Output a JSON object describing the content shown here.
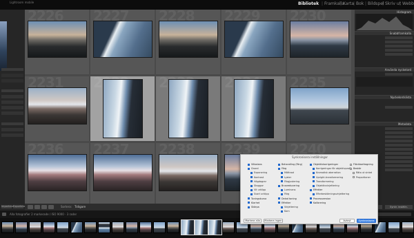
{
  "app": {
    "subtitle": "Lightroom mobile",
    "modules": [
      {
        "label": "Bibliotek",
        "active": true
      },
      {
        "label": "Framkalla",
        "active": false
      },
      {
        "label": "Karta",
        "active": false
      },
      {
        "label": "Bok",
        "active": false
      },
      {
        "label": "Bildspel",
        "active": false
      },
      {
        "label": "Skriv ut",
        "active": false
      },
      {
        "label": "Webb",
        "active": false
      }
    ]
  },
  "grid": {
    "cells": [
      {
        "num": "2226",
        "info": "",
        "thumb": "t-arch",
        "state": "normal"
      },
      {
        "num": "2227",
        "info": "",
        "thumb": "t-shore",
        "state": "normal"
      },
      {
        "num": "2228",
        "info": "",
        "thumb": "t-arch",
        "state": "normal"
      },
      {
        "num": "2229",
        "info": "",
        "thumb": "t-shore",
        "state": "normal"
      },
      {
        "num": "2230",
        "info": "",
        "thumb": "t-sunset",
        "state": "normal"
      },
      {
        "num": "2231",
        "info": "",
        "thumb": "t-mnt",
        "state": "normal"
      },
      {
        "num": "2232",
        "info": "",
        "thumb": "t-vert",
        "state": "hl"
      },
      {
        "num": "2233",
        "info": "",
        "thumb": "t-vert",
        "state": "sel"
      },
      {
        "num": "2234",
        "info": "",
        "thumb": "t-vert",
        "state": "sel"
      },
      {
        "num": "2235",
        "info": "",
        "thumb": "t-flat",
        "state": "normal"
      },
      {
        "num": "2236",
        "info": "",
        "thumb": "t-mnt2",
        "state": "normal"
      },
      {
        "num": "2237",
        "info": "",
        "thumb": "t-mnt2",
        "state": "normal"
      },
      {
        "num": "2238",
        "info": "",
        "thumb": "t-mnt",
        "state": "normal"
      },
      {
        "num": "2239",
        "info": "",
        "thumb": "t-sunset",
        "state": "normal"
      },
      {
        "num": "2240",
        "info": "",
        "thumb": "t-flat",
        "state": "normal"
      }
    ]
  },
  "right_panel": {
    "histogram_title": "Histogram",
    "quick_develop_title": "Snabbframkalla",
    "keywording_title": "Använda nyckelord",
    "keyword_list_title": "Nyckelordslista",
    "metadata_title": "Metadata",
    "sync_button": "Synkronisera",
    "sync_settings_button": "Synkr. inställn."
  },
  "left_panel": {
    "import_button": "Importera...",
    "export_button": "Exportera..."
  },
  "toolbar": {
    "sort_label": "Sortera:",
    "sort_value": "Tidigare",
    "thumbnails_label": "Miniatyrer"
  },
  "filmbar": {
    "path_text": "Alla fotografier   2 markerade / ISO 9000 · 3 rader",
    "filter_label": "Filter:"
  },
  "dialog": {
    "title": "Synkronisera inställningar",
    "col1": [
      {
        "label": "Vitbalans",
        "sub": false,
        "checked": true
      },
      {
        "label": "Grund",
        "sub": false,
        "checked": true
      },
      {
        "label": "Exponering",
        "sub": true,
        "checked": true
      },
      {
        "label": "Kontrast",
        "sub": true,
        "checked": true
      },
      {
        "label": "Högdagrar",
        "sub": true,
        "checked": true
      },
      {
        "label": "Skuggor",
        "sub": true,
        "checked": true
      },
      {
        "label": "Vit urklipp",
        "sub": true,
        "checked": true
      },
      {
        "label": "Svart urklipp",
        "sub": true,
        "checked": true
      },
      {
        "label": "Toningskurva",
        "sub": false,
        "checked": true
      },
      {
        "label": "Klarhet",
        "sub": false,
        "checked": true
      },
      {
        "label": "Skärpa",
        "sub": false,
        "checked": true
      }
    ],
    "col2": [
      {
        "label": "Behandling (Färg)",
        "sub": false,
        "checked": true
      },
      {
        "label": "Färg",
        "sub": false,
        "checked": true
      },
      {
        "label": "Mättnad",
        "sub": true,
        "checked": true
      },
      {
        "label": "Lyster",
        "sub": true,
        "checked": true
      },
      {
        "label": "Färgjustering",
        "sub": true,
        "checked": true
      },
      {
        "label": "Brusreducering",
        "sub": false,
        "checked": true
      },
      {
        "label": "Luminans",
        "sub": true,
        "checked": true
      },
      {
        "label": "Färg",
        "sub": true,
        "checked": true
      },
      {
        "label": "Delad toning",
        "sub": false,
        "checked": true
      },
      {
        "label": "Effekter",
        "sub": false,
        "checked": true
      },
      {
        "label": "Vinjettering",
        "sub": true,
        "checked": true
      },
      {
        "label": "Korn",
        "sub": true,
        "checked": true
      }
    ],
    "col3": [
      {
        "label": "Objektivkorrigeringar",
        "sub": false,
        "checked": true
      },
      {
        "label": "Korrigeringar för objektivprofil",
        "sub": true,
        "checked": true
      },
      {
        "label": "Kromatisk aberration",
        "sub": true,
        "checked": true
      },
      {
        "label": "Upright-transformering",
        "sub": true,
        "checked": true
      },
      {
        "label": "Transformering",
        "sub": true,
        "checked": true
      },
      {
        "label": "Objektivvinjettering",
        "sub": true,
        "checked": true
      },
      {
        "label": "Effekter",
        "sub": false,
        "checked": true
      },
      {
        "label": "Efterbeskärningsvinjettering",
        "sub": true,
        "checked": true
      },
      {
        "label": "Processversion",
        "sub": false,
        "checked": true
      },
      {
        "label": "Kalibrering",
        "sub": false,
        "checked": true
      }
    ],
    "col4": [
      {
        "label": "Fläckborttagning",
        "sub": false,
        "checked": false
      },
      {
        "label": "Beskär",
        "sub": false,
        "checked": false
      },
      {
        "label": "Räta ut vinkel",
        "sub": true,
        "checked": false
      },
      {
        "label": "Proportioner",
        "sub": true,
        "checked": false
      }
    ],
    "check_all_button": "Markera alla",
    "check_none_button": "Markera ingen",
    "cancel_button": "Avbryt",
    "sync_button": "Synkronisera"
  },
  "filmstrip": {
    "thumbs": [
      "t-arch",
      "t-sunset",
      "t-mnt",
      "t-mnt2",
      "t-flat",
      "t-shore",
      "t-arch",
      "t-shore2",
      "t-mnt",
      "t-sunset",
      "t-mnt2",
      "t-flat",
      "t-arch",
      "t-vert",
      "t-vert",
      "t-vert",
      "t-mnt",
      "t-flat",
      "t-sunset",
      "t-mnt2",
      "t-arch",
      "t-shore",
      "t-mnt",
      "t-flat",
      "t-sunset",
      "t-mnt2",
      "t-arch",
      "t-shore",
      "t-flat",
      "t-mnt"
    ],
    "selected": [
      13,
      14,
      15
    ]
  }
}
